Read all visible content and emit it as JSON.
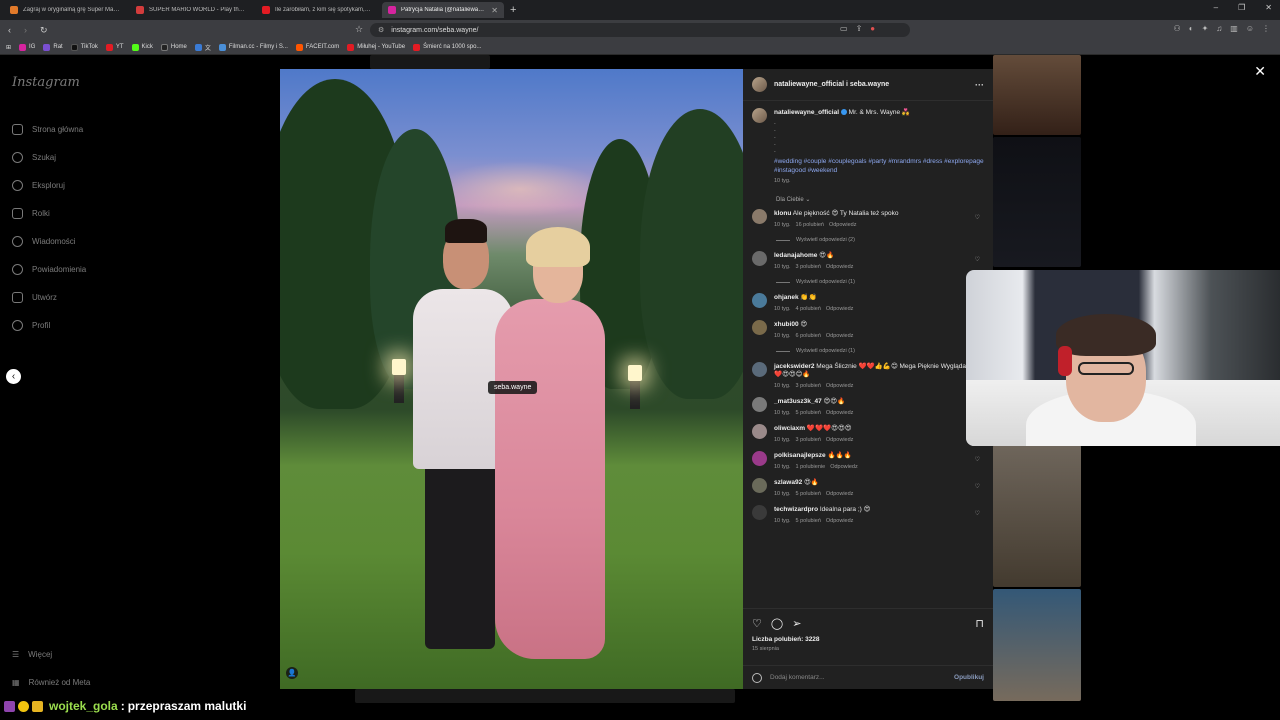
{
  "browser": {
    "tabs": [
      {
        "label": "Zagraj w oryginalną grę Super Mario",
        "color": "#e27a2a",
        "active": false
      },
      {
        "label": "SUPER MARIO WORLD - Play the ro",
        "color": "#d33c3c",
        "active": false
      },
      {
        "label": "Ile zarobiłam, z kim się spotykam, cz",
        "color": "#e31b23",
        "active": false
      },
      {
        "label": "Patrycja Natalia (@nataliewayne",
        "color": "#d6249f",
        "active": true
      }
    ],
    "new_tab": "+",
    "window_controls": [
      "–",
      "❐",
      "✕"
    ],
    "url": "instagram.com/seba.wayne/",
    "bookmarks": [
      {
        "label": "IG",
        "color": "#d6249f"
      },
      {
        "label": "Rat",
        "color": "#7a4fd1"
      },
      {
        "label": "TikTok",
        "color": "#111111"
      },
      {
        "label": "YT",
        "color": "#e31b23"
      },
      {
        "label": "Kick",
        "color": "#53fc18"
      },
      {
        "label": "Home",
        "color": "#222222"
      },
      {
        "label": "文",
        "color": "#3a7bd5"
      },
      {
        "label": "Filman.cc - Filmy i S...",
        "color": "#4a8fd8"
      },
      {
        "label": "FACEIT.com",
        "color": "#ff5500"
      },
      {
        "label": "Miłuhej - YouTube",
        "color": "#e31b23"
      },
      {
        "label": "Śmierć na 1000 spo...",
        "color": "#e31b23"
      }
    ]
  },
  "instagram": {
    "logo": "Instagram",
    "nav": [
      "Strona główna",
      "Szukaj",
      "Eksploruj",
      "Rolki",
      "Wiadomości",
      "Powiadomienia",
      "Utwórz",
      "Profil"
    ],
    "bottom_nav": [
      "Więcej",
      "Również od Meta"
    ],
    "close_icon": "✕",
    "prev_arrow": "‹"
  },
  "post": {
    "header_users": "nataliewayne_official i seba.wayne",
    "tag_label": "seba.wayne",
    "caption_user": "nataliewayne_official",
    "caption_text": "Mr. & Mrs. Wayne 💑",
    "dots": [
      ".",
      ".",
      ".",
      ".",
      "."
    ],
    "hashtags": "#wedding #couple #couplegoals #party #mrandmrs #dress #explorepage #instagood #weekend",
    "caption_time": "10 tyg.",
    "for_you": "Dla Ciebie ⌄",
    "comments": [
      {
        "user": "klonu",
        "text": "Ale piękność 😍 Ty Natalia też spoko",
        "time": "10 tyg.",
        "likes": "16 polubień",
        "reply": "Odpowiedz",
        "replies": "Wyświetl odpowiedzi (2)",
        "avatar": "#8a7a6a"
      },
      {
        "user": "ledanajahome",
        "text": "😍🔥",
        "time": "10 tyg.",
        "likes": "3 polubień",
        "reply": "Odpowiedz",
        "replies": "Wyświetl odpowiedzi (1)",
        "avatar": "#6a6a6a"
      },
      {
        "user": "ohjanek",
        "text": "👏👏",
        "time": "10 tyg.",
        "likes": "4 polubień",
        "reply": "Odpowiedz",
        "replies": "",
        "avatar": "#4a7a9a"
      },
      {
        "user": "xhubi00",
        "text": "😍",
        "time": "10 tyg.",
        "likes": "6 polubień",
        "reply": "Odpowiedz",
        "replies": "Wyświetl odpowiedzi (1)",
        "avatar": "#7a6a4a"
      },
      {
        "user": "jacekswider2",
        "text": "Mega Ślicznie ❤️❤️👍💪😊 Mega Pięknie Wyglądacie ❤️😍😍😊🔥",
        "time": "10 tyg.",
        "likes": "3 polubień",
        "reply": "Odpowiedz",
        "replies": "",
        "avatar": "#5a6a7a"
      },
      {
        "user": "_mat3usz3k_47",
        "text": "😍😍🔥",
        "time": "10 tyg.",
        "likes": "5 polubień",
        "reply": "Odpowiedz",
        "replies": "",
        "avatar": "#7a7a7a"
      },
      {
        "user": "oliwciaxm",
        "text": "❤️❤️❤️😍😍😍",
        "time": "10 tyg.",
        "likes": "3 polubień",
        "reply": "Odpowiedz",
        "replies": "",
        "avatar": "#9a8a8a"
      },
      {
        "user": "polkisanajlepsze",
        "text": "🔥🔥🔥",
        "time": "10 tyg.",
        "likes": "1 polubienie",
        "reply": "Odpowiedz",
        "replies": "",
        "avatar": "#9a3a8a"
      },
      {
        "user": "szlawa92",
        "text": "😍🔥",
        "time": "10 tyg.",
        "likes": "5 polubień",
        "reply": "Odpowiedz",
        "replies": "",
        "avatar": "#6a6a5a"
      },
      {
        "user": "techwizardpro",
        "text": "Idealna para ;) 😍",
        "time": "10 tyg.",
        "likes": "5 polubień",
        "reply": "Odpowiedz",
        "replies": "",
        "avatar": "#3a3a3a"
      }
    ],
    "likes_label": "Liczba polubień: 3228",
    "date": "15 sierpnia",
    "add_comment_placeholder": "Dodaj komentarz...",
    "publish": "Opublikuj"
  },
  "chat": {
    "username": "wojtek_gola",
    "separator": ":",
    "message": "przepraszam malutki"
  },
  "colors": {
    "panel_bg": "#212121",
    "hashtag": "#8da8f0",
    "chat_username": "#9bde4e"
  }
}
